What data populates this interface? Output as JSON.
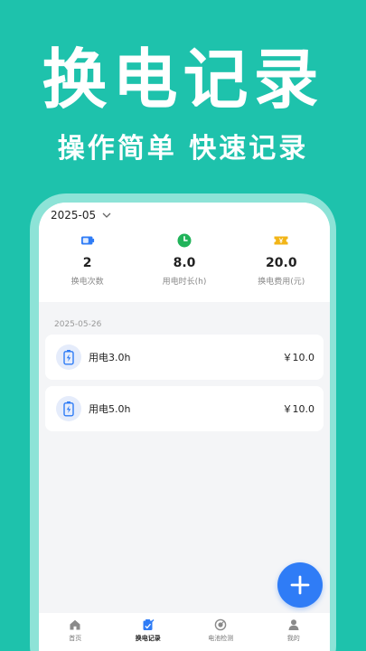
{
  "promo": {
    "title": "换电记录",
    "subtitle": "操作简单 快速记录"
  },
  "header": {
    "month": "2025-05"
  },
  "stats": [
    {
      "icon": "battery-icon",
      "value": "2",
      "label": "换电次数",
      "color": "#2f7cf6"
    },
    {
      "icon": "clock-icon",
      "value": "8.0",
      "label": "用电时长(h)",
      "color": "#21b35a"
    },
    {
      "icon": "ticket-icon",
      "value": "20.0",
      "label": "换电费用(元)",
      "color": "#f2b517"
    }
  ],
  "records": {
    "date": "2025-05-26",
    "items": [
      {
        "title": "用电3.0h",
        "amount": "￥10.0"
      },
      {
        "title": "用电5.0h",
        "amount": "￥10.0"
      }
    ]
  },
  "nav": [
    {
      "icon": "home-icon",
      "label": "首页",
      "active": false
    },
    {
      "icon": "records-icon",
      "label": "换电记录",
      "active": true
    },
    {
      "icon": "battery-check-icon",
      "label": "电池检测",
      "active": false
    },
    {
      "icon": "user-icon",
      "label": "我的",
      "active": false
    }
  ],
  "colors": {
    "background": "#1ec2ac",
    "accent": "#2f7cf6"
  }
}
